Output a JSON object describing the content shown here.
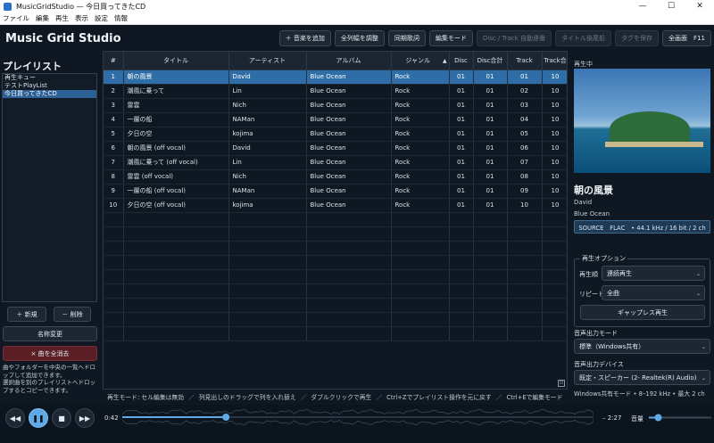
{
  "window": {
    "title": "MusicGridStudio — 今日買ってきたCD",
    "min": "—",
    "max": "☐",
    "close": "✕"
  },
  "menu": [
    "ファイル",
    "編集",
    "再生",
    "表示",
    "設定",
    "情報"
  ],
  "app_title": "Music Grid Studio",
  "toolbar": {
    "add_music": "＋ 音楽を追加",
    "adjust_columns": "全列幅を調整",
    "sync_lyrics": "同期歌詞",
    "edit_mode": "編集モード",
    "disc_track_auto": "Disc / Track 自動連番",
    "title_postprocess": "タイトル後尾処",
    "save_tags": "タグを保存",
    "fullscreen": "全画面　F11"
  },
  "sidebar": {
    "title": "プレイリスト",
    "items": [
      "再生キュー",
      "テストPlayList",
      "今日買ってきたCD"
    ],
    "selected": 2,
    "new_label": "＋ 新規",
    "delete_label": "－ 削除",
    "rename_label": "名称変更",
    "clear_label": "× 曲を全消去",
    "hint": "曲やフォルダーを中央の一覧へドロップして追加できます。\n選択曲を別のプレイリストへドロップするとコピーできます。"
  },
  "table": {
    "columns": [
      "#",
      "タイトル",
      "アーティスト",
      "アルバム",
      "ジャンル",
      "Disc",
      "Disc合計",
      "Track",
      "Track合"
    ],
    "sort_indicator": "▲",
    "rows": [
      [
        "1",
        "朝の風景",
        "David",
        "Blue Ocean",
        "Rock",
        "01",
        "01",
        "01",
        "10"
      ],
      [
        "2",
        "潮風に乗って",
        "Lin",
        "Blue Ocean",
        "Rock",
        "01",
        "01",
        "02",
        "10"
      ],
      [
        "3",
        "雷雲",
        "Nich",
        "Blue Ocean",
        "Rock",
        "01",
        "01",
        "03",
        "10"
      ],
      [
        "4",
        "一層の船",
        "NAMan",
        "Blue Ocean",
        "Rock",
        "01",
        "01",
        "04",
        "10"
      ],
      [
        "5",
        "夕日の空",
        "kojima",
        "Blue Ocean",
        "Rock",
        "01",
        "01",
        "05",
        "10"
      ],
      [
        "6",
        "朝の風景 (off vocal)",
        "David",
        "Blue Ocean",
        "Rock",
        "01",
        "01",
        "06",
        "10"
      ],
      [
        "7",
        "潮風に乗って (off vocal)",
        "Lin",
        "Blue Ocean",
        "Rock",
        "01",
        "01",
        "07",
        "10"
      ],
      [
        "8",
        "雷雲 (off vocal)",
        "Nich",
        "Blue Ocean",
        "Rock",
        "01",
        "01",
        "08",
        "10"
      ],
      [
        "9",
        "一層の船 (off vocal)",
        "NAMan",
        "Blue Ocean",
        "Rock",
        "01",
        "01",
        "09",
        "10"
      ],
      [
        "10",
        "夕日の空 (off vocal)",
        "kojima",
        "Blue Ocean",
        "Rock",
        "01",
        "01",
        "10",
        "10"
      ]
    ],
    "selected_row": 0
  },
  "status": [
    "再生モード: セル編集は無効",
    "列見出しのドラッグで列を入れ替え",
    "ダブルクリックで再生",
    "Ctrl+Zでプレイリスト操作を元に戻す",
    "Ctrl+Eで編集モード"
  ],
  "status_sep": "／",
  "now_playing": {
    "label": "再生中",
    "title": "朝の風景",
    "artist": "David",
    "album": "Blue Ocean",
    "format": "SOURCE　FLAC　• 44.1 kHz / 16 bit / 2 ch"
  },
  "options": {
    "title": "再生オプション",
    "order_label": "再生順",
    "order_value": "連続再生",
    "repeat_label": "リピート",
    "repeat_value": "全曲",
    "gapless_label": "ギャップレス再生"
  },
  "output": {
    "mode_label": "音声出力モード",
    "mode_value": "標準（Windows共有）",
    "device_label": "音声出力デバイス",
    "device_value": "既定・スピーカー (2- Realtek(R) Audio)",
    "info": "Windows共有モード • 8–192 kHz • 最大 2 ch"
  },
  "transport": {
    "prev": "◀◀",
    "play_pause": "❚❚",
    "stop": "■",
    "next": "▶▶",
    "elapsed": "0:42",
    "remaining": "– 2:27",
    "progress": 0.22,
    "volume_label": "音量",
    "volume": 0.15
  },
  "colors": {
    "accent": "#5fa9e6",
    "selection": "#2f6da6",
    "background": "#0f1822"
  },
  "icons": {
    "corner": "⊡",
    "chevron": "⌄"
  }
}
